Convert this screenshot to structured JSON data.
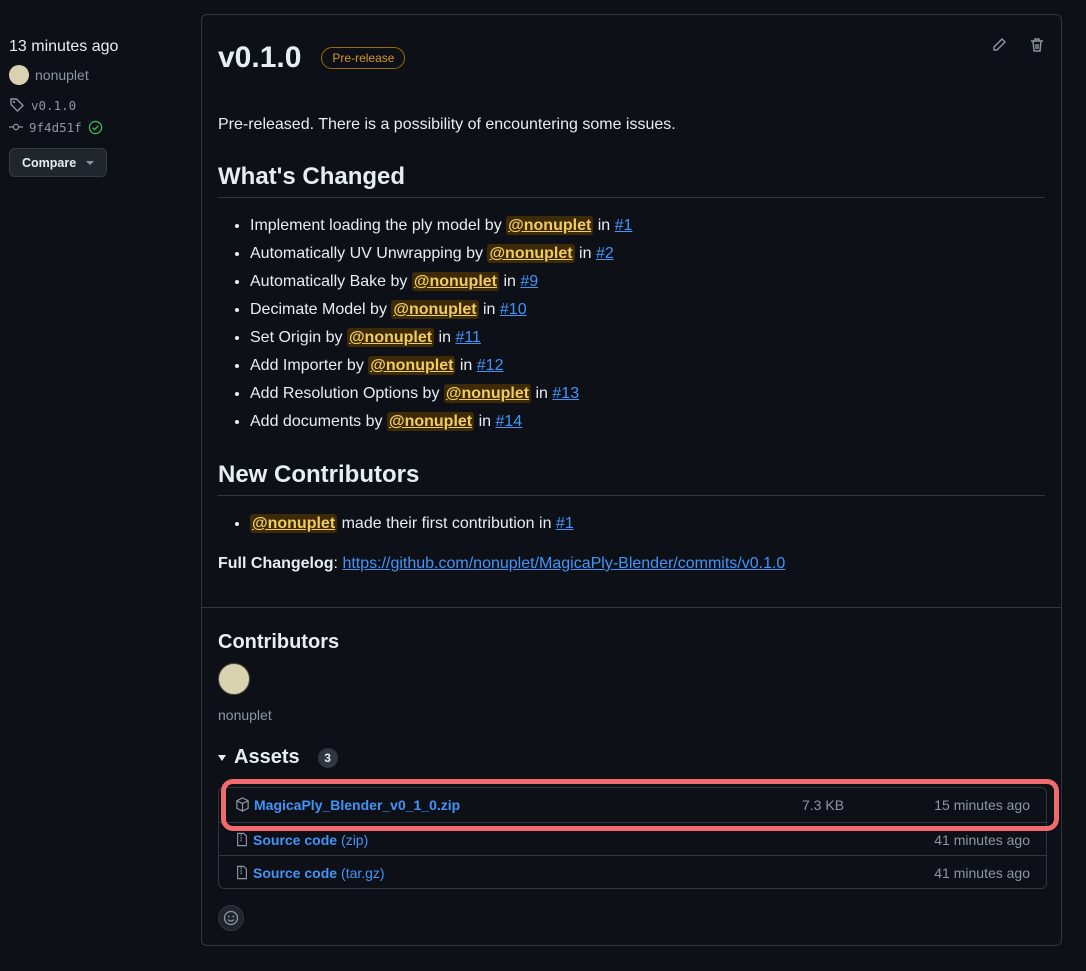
{
  "side": {
    "time": "13 minutes ago",
    "author": "nonuplet",
    "tag": "v0.1.0",
    "commit": "9f4d51f",
    "compare_label": "Compare"
  },
  "release": {
    "title": "v0.1.0",
    "badge": "Pre-release",
    "intro": "Pre-released. There is a possibility of encountering some issues.",
    "whats_changed_heading": "What's Changed",
    "changes": [
      {
        "text": "Implement loading the ply model by",
        "mention": "@nonuplet",
        "in": "in",
        "pr": "#1"
      },
      {
        "text": "Automatically UV Unwrapping by",
        "mention": "@nonuplet",
        "in": "in",
        "pr": "#2"
      },
      {
        "text": "Automatically Bake by",
        "mention": "@nonuplet",
        "in": "in",
        "pr": "#9"
      },
      {
        "text": "Decimate Model by",
        "mention": "@nonuplet",
        "in": "in",
        "pr": "#10"
      },
      {
        "text": "Set Origin by",
        "mention": "@nonuplet",
        "in": "in",
        "pr": "#11"
      },
      {
        "text": "Add Importer by",
        "mention": "@nonuplet",
        "in": "in",
        "pr": "#12"
      },
      {
        "text": "Add Resolution Options by",
        "mention": "@nonuplet",
        "in": "in",
        "pr": "#13"
      },
      {
        "text": "Add documents by",
        "mention": "@nonuplet",
        "in": "in",
        "pr": "#14"
      }
    ],
    "new_contributors_heading": "New Contributors",
    "new_contributor": {
      "mention": "@nonuplet",
      "text": "made their first contribution in",
      "pr": "#1"
    },
    "changelog_label": "Full Changelog",
    "changelog_url": "https://github.com/nonuplet/MagicaPly-Blender/commits/v0.1.0"
  },
  "contributors": {
    "title": "Contributors",
    "name": "nonuplet"
  },
  "assets": {
    "title": "Assets",
    "count": "3",
    "items": [
      {
        "name": "MagicaPly_Blender_v0_1_0.zip",
        "suffix": "",
        "size": "7.3 KB",
        "date": "15 minutes ago",
        "icon": "package-icon"
      },
      {
        "name": "Source code",
        "suffix": "(zip)",
        "size": "",
        "date": "41 minutes ago",
        "icon": "file-zip-icon"
      },
      {
        "name": "Source code",
        "suffix": "(tar.gz)",
        "size": "",
        "date": "41 minutes ago",
        "icon": "file-zip-icon"
      }
    ]
  },
  "colors": {
    "background": "#0d1117",
    "link": "#4493f8",
    "mention_bg": "#3d2a07",
    "mention_fg": "#f2cc60",
    "prerelease": "#d29922",
    "highlight": "#f06a6e"
  }
}
